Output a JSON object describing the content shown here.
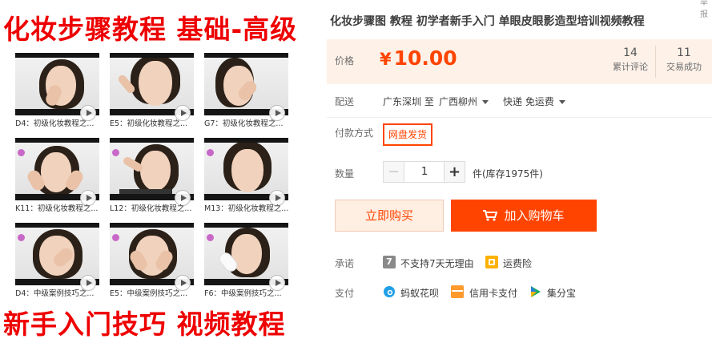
{
  "product_image": {
    "banner_top": "化妆步骤教程 基础-高级",
    "banner_bottom": "新手入门技巧 视频教程",
    "thumbnails": [
      {
        "caption": "D4：初级化妆教程之..."
      },
      {
        "caption": "E5：初级化妆教程之..."
      },
      {
        "caption": "G7：初级化妆教程之..."
      },
      {
        "caption": "K11：初级化妆教程之..."
      },
      {
        "caption": "L12：初级化妆教程之..."
      },
      {
        "caption": "M13：初级化妆教程之..."
      },
      {
        "caption": "D4：中级案例技巧之..."
      },
      {
        "caption": "E5：中级案例技巧之..."
      },
      {
        "caption": "F6：中级案例技巧之..."
      }
    ]
  },
  "product": {
    "title": "化妆步骤图 教程 初学者新手入门 单眼皮眼影造型培训视频教程",
    "corner_mark": "举报"
  },
  "price": {
    "label": "价格",
    "currency": "¥",
    "value": "10.00",
    "reviews_count": "14",
    "reviews_label": "累计评论",
    "sales_count": "11",
    "sales_label": "交易成功"
  },
  "delivery": {
    "label": "配送",
    "from_text": "广东深圳 至",
    "to_location": "广西柳州",
    "shipping": "快递 免运费"
  },
  "payment_method": {
    "label": "付款方式",
    "option": "网盘发货"
  },
  "quantity": {
    "label": "数量",
    "minus": "−",
    "value": "1",
    "plus": "+",
    "stock_text": "件(库存1975件)"
  },
  "actions": {
    "buy_now": "立即购买",
    "add_to_cart": "加入购物车"
  },
  "promise": {
    "label": "承诺",
    "no_return_icon": "7",
    "no_return_text": "不支持7天无理由",
    "shipping_insurance_text": "运费险"
  },
  "pay": {
    "label": "支付",
    "huabei": "蚂蚁花呗",
    "credit_card": "信用卡支付",
    "jifenbao": "集分宝"
  },
  "colors": {
    "accent": "#ff4400",
    "price_bg": "#fdf1e8",
    "banner_red": "#ee0000"
  }
}
